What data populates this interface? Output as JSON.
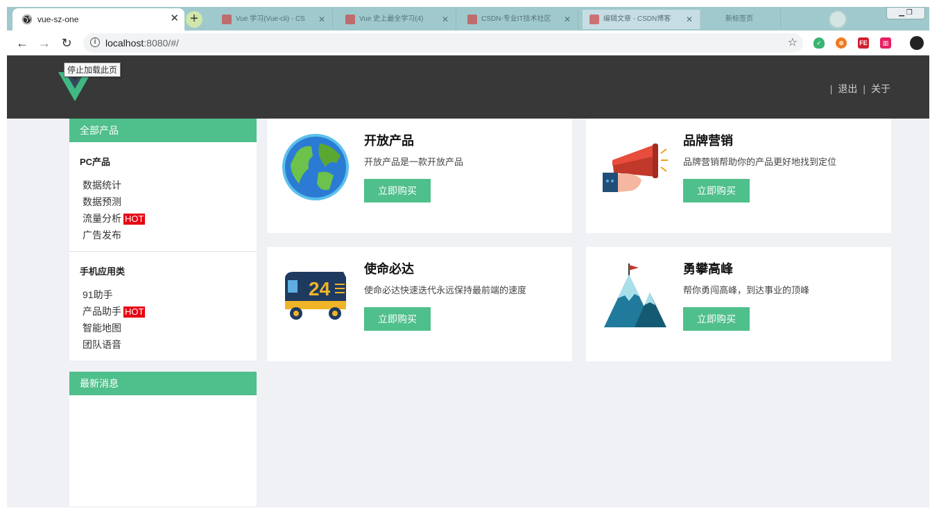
{
  "browser": {
    "active_tab_title": "vue-sz-one",
    "new_tab_symbol": "+",
    "background_tabs": [
      {
        "title": "Vue 学习(Vue-cli) - CS"
      },
      {
        "title": "Vue 史上最全学习(4)"
      },
      {
        "title": "CSDN-专业IT技术社区"
      },
      {
        "title": "编辑文章 - CSDN博客"
      },
      {
        "title": "新标签页"
      }
    ],
    "url_host": "localhost",
    "url_path": ":8080/#/",
    "tooltip": "停止加载此页"
  },
  "header": {
    "nav": [
      {
        "label": "退出"
      },
      {
        "label": "关于"
      }
    ],
    "separator": "|"
  },
  "sidebar": {
    "products_panel_title": "全部产品",
    "groups": [
      {
        "title": "PC产品",
        "items": [
          {
            "label": "数据统计",
            "badge": ""
          },
          {
            "label": "数据预测",
            "badge": ""
          },
          {
            "label": "流量分析",
            "badge": "HOT"
          },
          {
            "label": "广告发布",
            "badge": ""
          }
        ]
      },
      {
        "title": "手机应用类",
        "items": [
          {
            "label": "91助手",
            "badge": ""
          },
          {
            "label": "产品助手",
            "badge": "HOT"
          },
          {
            "label": "智能地图",
            "badge": ""
          },
          {
            "label": "团队语音",
            "badge": ""
          }
        ]
      }
    ],
    "news_panel_title": "最新消息"
  },
  "products": [
    {
      "title": "开放产品",
      "description": "开放产品是一款开放产品",
      "button": "立即购买",
      "icon": "globe-icon"
    },
    {
      "title": "品牌营销",
      "description": "品牌营销帮助你的产品更好地找到定位",
      "button": "立即购买",
      "icon": "megaphone-icon"
    },
    {
      "title": "使命必达",
      "description": "使命必达快速迭代永远保持最前端的速度",
      "button": "立即购买",
      "icon": "delivery-truck-icon"
    },
    {
      "title": "勇攀高峰",
      "description": "帮你勇闯高峰，到达事业的顶峰",
      "button": "立即购买",
      "icon": "mountain-icon"
    }
  ],
  "colors": {
    "accent": "#4fbf8b",
    "header_bg": "#383838",
    "page_bg": "#f0f1f5",
    "hot_badge": "#e60012"
  }
}
